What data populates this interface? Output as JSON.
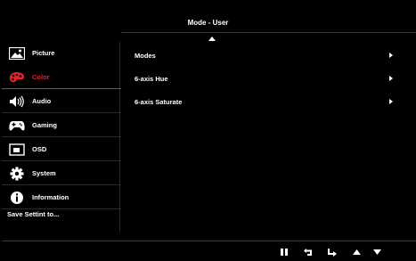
{
  "header": {
    "title": "Mode - User"
  },
  "sidebar": {
    "items": [
      {
        "label": "Picture",
        "icon": "picture-icon"
      },
      {
        "label": "Color",
        "icon": "palette-icon",
        "active": true
      },
      {
        "label": "Audio",
        "icon": "speaker-icon"
      },
      {
        "label": "Gaming",
        "icon": "gamepad-icon"
      },
      {
        "label": "OSD",
        "icon": "osd-icon"
      },
      {
        "label": "System",
        "icon": "gear-icon"
      },
      {
        "label": "Information",
        "icon": "info-icon"
      }
    ],
    "save_label": "Save Settint to..."
  },
  "menu": {
    "items": [
      {
        "label": "Modes"
      },
      {
        "label": "6-axis Hue"
      },
      {
        "label": "6-axis Saturate"
      }
    ]
  },
  "bottom_bar": {
    "buttons": [
      "pause-icon",
      "return-icon",
      "enter-icon",
      "up-icon",
      "down-icon"
    ]
  },
  "colors": {
    "accent": "#e8202a",
    "background": "#000000",
    "text": "#ffffff"
  }
}
